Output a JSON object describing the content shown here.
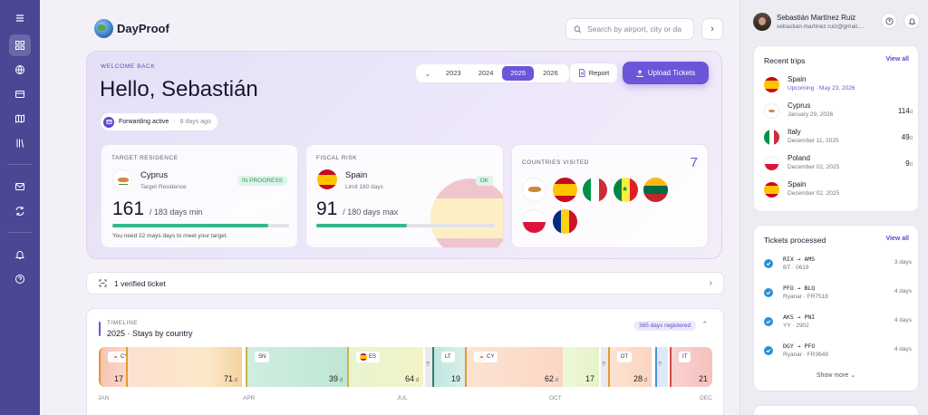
{
  "app": {
    "name": "DayProof"
  },
  "search": {
    "placeholder": "Search by airport, city or da"
  },
  "hero": {
    "welcome": "WELCOME BACK",
    "greeting": "Hello, Sebastián",
    "forwarding": {
      "label": "Forwarding active",
      "time": "8 days ago"
    },
    "years": [
      "2023",
      "2024",
      "2025",
      "2026"
    ],
    "selected_year": "2025",
    "report_label": "Report",
    "upload_label": "Upload Tickets"
  },
  "target": {
    "label": "TARGET RESIDENCE",
    "country": "Cyprus",
    "sub": "Target Residence",
    "status": "IN PROGRESS",
    "days": "161",
    "of": "/ 183 days min",
    "progress": 0.88,
    "note": "You need 22 mays days to meet your target."
  },
  "fiscal": {
    "label": "FISCAL RISK",
    "country": "Spain",
    "sub": "Limit 180 days",
    "status": "OK",
    "days": "91",
    "of": "/ 180 days max",
    "progress": 0.506
  },
  "countries": {
    "label": "COUNTRIES VISITED",
    "count": "7",
    "flags": [
      "cyprus",
      "spain",
      "italy",
      "senegal",
      "lithuania",
      "poland",
      "romania"
    ]
  },
  "verified": {
    "text": "1 verified ticket"
  },
  "timeline": {
    "label": "TIMELINE",
    "title": "2025 · Stays by country",
    "badge": "365 days registered",
    "segments": [
      {
        "tag": "CY",
        "days": "17",
        "unit": ""
      },
      {
        "tag": "",
        "days": "71",
        "unit": "d"
      },
      {
        "tag": "SN",
        "days": "39",
        "unit": "d"
      },
      {
        "tag": "ES",
        "days": "64",
        "unit": "d"
      },
      {
        "tag": "?",
        "days": "",
        "unit": ""
      },
      {
        "tag": "LT",
        "days": "19",
        "unit": ""
      },
      {
        "tag": "CY",
        "days": "62",
        "unit": "d"
      },
      {
        "tag": "",
        "days": "17",
        "unit": ""
      },
      {
        "tag": "?",
        "days": "",
        "unit": ""
      },
      {
        "tag": "DT",
        "days": "28",
        "unit": "d"
      },
      {
        "tag": "?",
        "days": "",
        "unit": ""
      },
      {
        "tag": "IT",
        "days": "21",
        "unit": ""
      }
    ],
    "months": [
      "JAN",
      "APR",
      "JUL",
      "OCT",
      "DEC"
    ]
  },
  "profile": {
    "name": "Sebastián Martínez Ruiz",
    "email": "sebastian.martinez.ruiz@gmail...."
  },
  "recent_trips": {
    "title": "Recent trips",
    "view_all": "View all",
    "items": [
      {
        "country": "Spain",
        "date": "Upcoming · May 23, 2026",
        "days": "",
        "upcoming": true,
        "flag": "spain"
      },
      {
        "country": "Cyprus",
        "date": "January 29, 2026",
        "days": "114",
        "unit": "d",
        "flag": "cyprus"
      },
      {
        "country": "Italy",
        "date": "December 11, 2025",
        "days": "49",
        "unit": "d",
        "flag": "italy"
      },
      {
        "country": "Poland",
        "date": "December 02, 2025",
        "days": "9",
        "unit": "d",
        "flag": "poland"
      },
      {
        "country": "Spain",
        "date": "December 02, 2025",
        "days": "",
        "flag": "spain"
      }
    ]
  },
  "tickets": {
    "title": "Tickets processed",
    "view_all": "View all",
    "show_more": "Show more",
    "items": [
      {
        "route": "RIX → AMS",
        "flight": "BT · 0619",
        "ago": "3 days"
      },
      {
        "route": "PFO → BLQ",
        "flight": "Ryanar · FR7518",
        "ago": "4 days"
      },
      {
        "route": "AKS → PNI",
        "flight": "YY · 2902",
        "ago": "4 days"
      },
      {
        "route": "DGY → PFO",
        "flight": "Ryanar · FR3649",
        "ago": "4 days"
      }
    ]
  },
  "colors": {
    "accent": "#6b55d9",
    "rail": "#4b4794",
    "ok": "#34b98a"
  }
}
